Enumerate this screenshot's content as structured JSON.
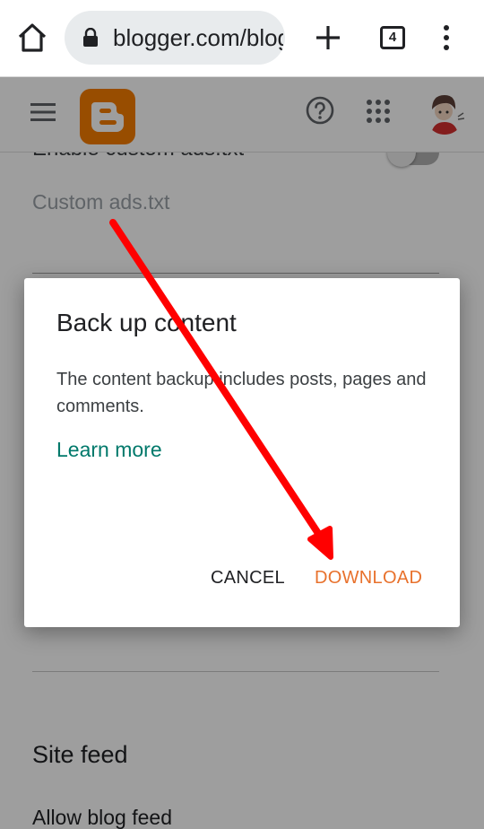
{
  "browser": {
    "url": "blogger.com/blog",
    "tab_count": "4"
  },
  "page": {
    "enable_custom_ads": "Enable custom ads.txt",
    "custom_ads_label": "Custom ads.txt",
    "site_feed_heading": "Site feed",
    "allow_blog_feed": "Allow blog feed"
  },
  "dialog": {
    "title": "Back up content",
    "body": "The content backup includes posts, pages and comments.",
    "learn_more": "Learn more",
    "cancel_label": "CANCEL",
    "download_label": "DOWNLOAD"
  },
  "colors": {
    "brand": "#f57d00",
    "accent_link": "#00796b",
    "download": "#e8712c",
    "annotation_arrow": "#ff0000"
  },
  "icons": [
    "home-icon",
    "lock-icon",
    "plus-icon",
    "tabs-icon",
    "more-vert-icon",
    "hamburger-icon",
    "blogger-logo",
    "help-icon",
    "apps-icon",
    "avatar"
  ]
}
